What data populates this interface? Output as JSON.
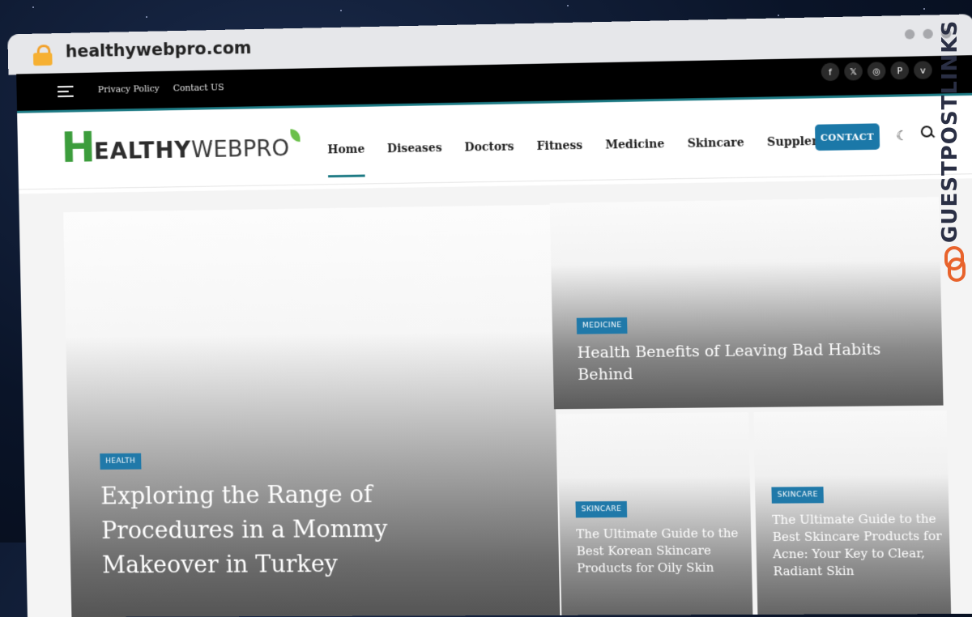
{
  "browser": {
    "url": "healthywebpro.com"
  },
  "topbar": {
    "links": [
      "Privacy Policy",
      "Contact US"
    ],
    "socials": [
      {
        "icon": "facebook-icon",
        "glyph": "f"
      },
      {
        "icon": "x-icon",
        "glyph": "𝕏"
      },
      {
        "icon": "instagram-icon",
        "glyph": "◎"
      },
      {
        "icon": "pinterest-icon",
        "glyph": "P"
      },
      {
        "icon": "vimeo-icon",
        "glyph": "v"
      }
    ]
  },
  "header": {
    "logo": {
      "first": "H",
      "middle": "EALTHY",
      "end": "WEBPRO"
    },
    "nav": [
      "Home",
      "Diseases",
      "Doctors",
      "Fitness",
      "Medicine",
      "Skincare",
      "Supplements"
    ],
    "active_nav": "Home",
    "contact_label": "CONTACT"
  },
  "featured": {
    "main": {
      "category": "HEALTH",
      "title": "Exploring the Range of Procedures in a Mommy Makeover in Turkey"
    },
    "top_right": {
      "category": "MEDICINE",
      "title": "Health Benefits of Leaving Bad Habits Behind"
    },
    "small_1": {
      "category": "SKINCARE",
      "title": "The Ultimate Guide to the Best Korean Skincare Products for Oily Skin"
    },
    "small_2": {
      "category": "SKINCARE",
      "title": "The Ultimate Guide to the Best Skincare Products for Acne: Your Key to Clear, Radiant Skin"
    }
  },
  "watermark": {
    "text": "GUESTPOSTLINKS"
  },
  "colors": {
    "accent": "#1d7a84",
    "badge": "#2079a9",
    "logo_green": "#3c9d3c"
  }
}
